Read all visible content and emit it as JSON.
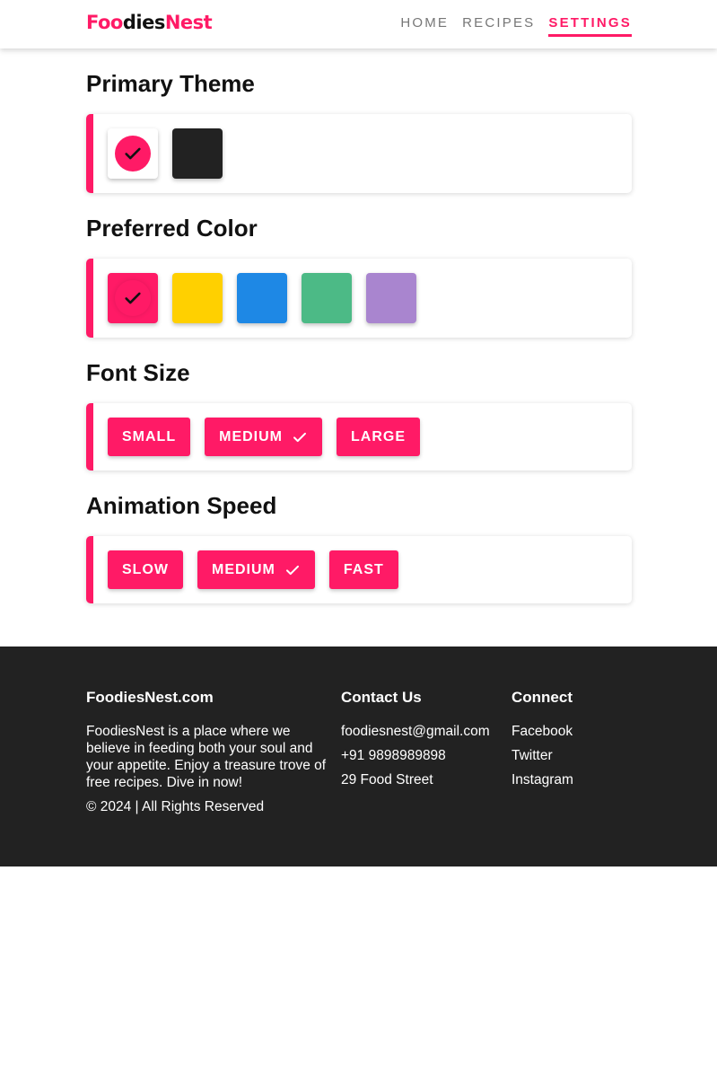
{
  "header": {
    "logo_part1": "Foo",
    "logo_part2": "dies",
    "logo_part3": "Nest",
    "nav": [
      {
        "label": "HOME",
        "active": false
      },
      {
        "label": "RECIPES",
        "active": false
      },
      {
        "label": "SETTINGS",
        "active": true
      }
    ]
  },
  "sections": {
    "primary_theme": {
      "title": "Primary Theme",
      "options": [
        {
          "color": "#ffffff",
          "selected": true
        },
        {
          "color": "#222222",
          "selected": false
        }
      ]
    },
    "preferred_color": {
      "title": "Preferred Color",
      "options": [
        {
          "color": "#ff1a66",
          "selected": true
        },
        {
          "color": "#ffd000",
          "selected": false
        },
        {
          "color": "#1e88e5",
          "selected": false
        },
        {
          "color": "#4cba86",
          "selected": false
        },
        {
          "color": "#a985cf",
          "selected": false
        }
      ]
    },
    "font_size": {
      "title": "Font Size",
      "options": [
        {
          "label": "SMALL",
          "selected": false
        },
        {
          "label": "MEDIUM",
          "selected": true
        },
        {
          "label": "LARGE",
          "selected": false
        }
      ]
    },
    "animation_speed": {
      "title": "Animation Speed",
      "options": [
        {
          "label": "SLOW",
          "selected": false
        },
        {
          "label": "MEDIUM",
          "selected": true
        },
        {
          "label": "FAST",
          "selected": false
        }
      ]
    }
  },
  "footer": {
    "about": {
      "title": "FoodiesNest.com",
      "text": "FoodiesNest is a place where we believe in feeding both your soul and your appetite. Enjoy a treasure trove of free recipes. Dive in now!",
      "copyright": "© 2024 | All Rights Reserved"
    },
    "contact": {
      "title": "Contact Us",
      "email": "foodiesnest@gmail.com",
      "phone": "+91 9898989898",
      "address": "29 Food Street"
    },
    "connect": {
      "title": "Connect",
      "links": [
        "Facebook",
        "Twitter",
        "Instagram"
      ]
    }
  },
  "colors": {
    "accent": "#ff1a66",
    "dark": "#222222",
    "check_icon": "#111111"
  },
  "icons": {
    "selected": "check-icon"
  }
}
